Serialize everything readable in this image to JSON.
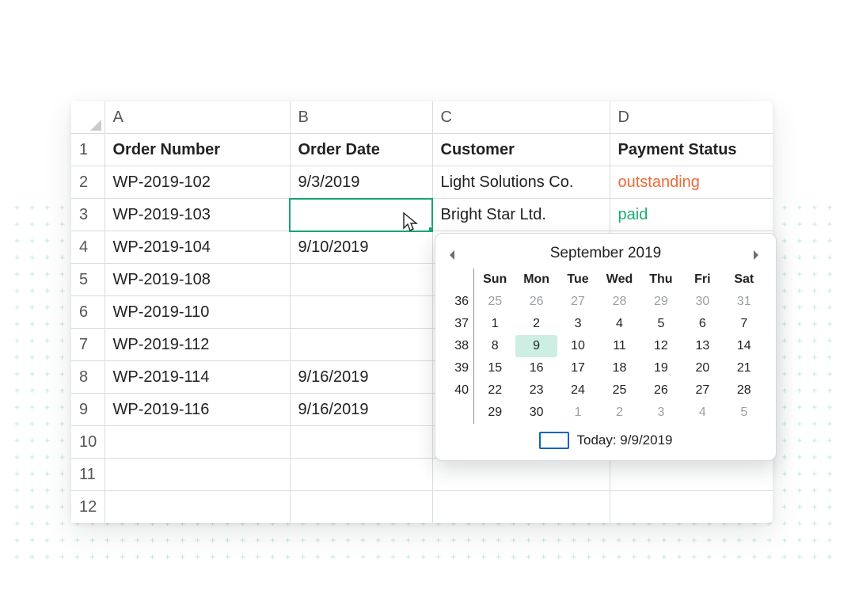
{
  "columns": [
    "A",
    "B",
    "C",
    "D"
  ],
  "headerRow": {
    "orderNumber": "Order Number",
    "orderDate": "Order Date",
    "customer": "Customer",
    "paymentStatus": "Payment Status"
  },
  "rows": [
    {
      "n": "1"
    },
    {
      "n": "2",
      "A": "WP-2019-102",
      "B": "9/3/2019",
      "C": "Light Solutions Co.",
      "D": "outstanding",
      "Dclass": "c-out"
    },
    {
      "n": "3",
      "A": "WP-2019-103",
      "B": "",
      "C": "Bright Star Ltd.",
      "D": "paid",
      "Dclass": "c-paid",
      "selB": true
    },
    {
      "n": "4",
      "A": "WP-2019-104",
      "B": "9/10/2019",
      "C": "",
      "D": ""
    },
    {
      "n": "5",
      "A": "WP-2019-108",
      "B": "",
      "C": "",
      "D": ""
    },
    {
      "n": "6",
      "A": "WP-2019-110",
      "B": "",
      "C": "",
      "D": ""
    },
    {
      "n": "7",
      "A": "WP-2019-112",
      "B": "",
      "C": "",
      "D": ""
    },
    {
      "n": "8",
      "A": "WP-2019-114",
      "B": "9/16/2019",
      "C": "",
      "D": ""
    },
    {
      "n": "9",
      "A": "WP-2019-116",
      "B": "9/16/2019",
      "C": "",
      "D": ""
    },
    {
      "n": "10"
    },
    {
      "n": "11"
    },
    {
      "n": "12"
    }
  ],
  "picker": {
    "month": "September 2019",
    "dow": [
      "Sun",
      "Mon",
      "Tue",
      "Wed",
      "Thu",
      "Fri",
      "Sat"
    ],
    "weeks": [
      "36",
      "37",
      "38",
      "39",
      "40"
    ],
    "prevTrail": [
      "25",
      "26",
      "27",
      "28",
      "29",
      "30",
      "31"
    ],
    "days": [
      [
        "1",
        "2",
        "3",
        "4",
        "5",
        "6",
        "7"
      ],
      [
        "8",
        "9",
        "10",
        "11",
        "12",
        "13",
        "14"
      ],
      [
        "15",
        "16",
        "17",
        "18",
        "19",
        "20",
        "21"
      ],
      [
        "22",
        "23",
        "24",
        "25",
        "26",
        "27",
        "28"
      ],
      [
        "29",
        "30",
        "1",
        "2",
        "3",
        "4",
        "5"
      ]
    ],
    "nextMuteFrom": {
      "row": 4,
      "col": 2
    },
    "selected": {
      "row": 1,
      "col": 1
    },
    "todayLabel": "Today: 9/9/2019"
  },
  "colors": {
    "outstanding": "#eb6a3a",
    "paid": "#1aab72",
    "selection": "#17a673",
    "link": "#0a64c2"
  }
}
